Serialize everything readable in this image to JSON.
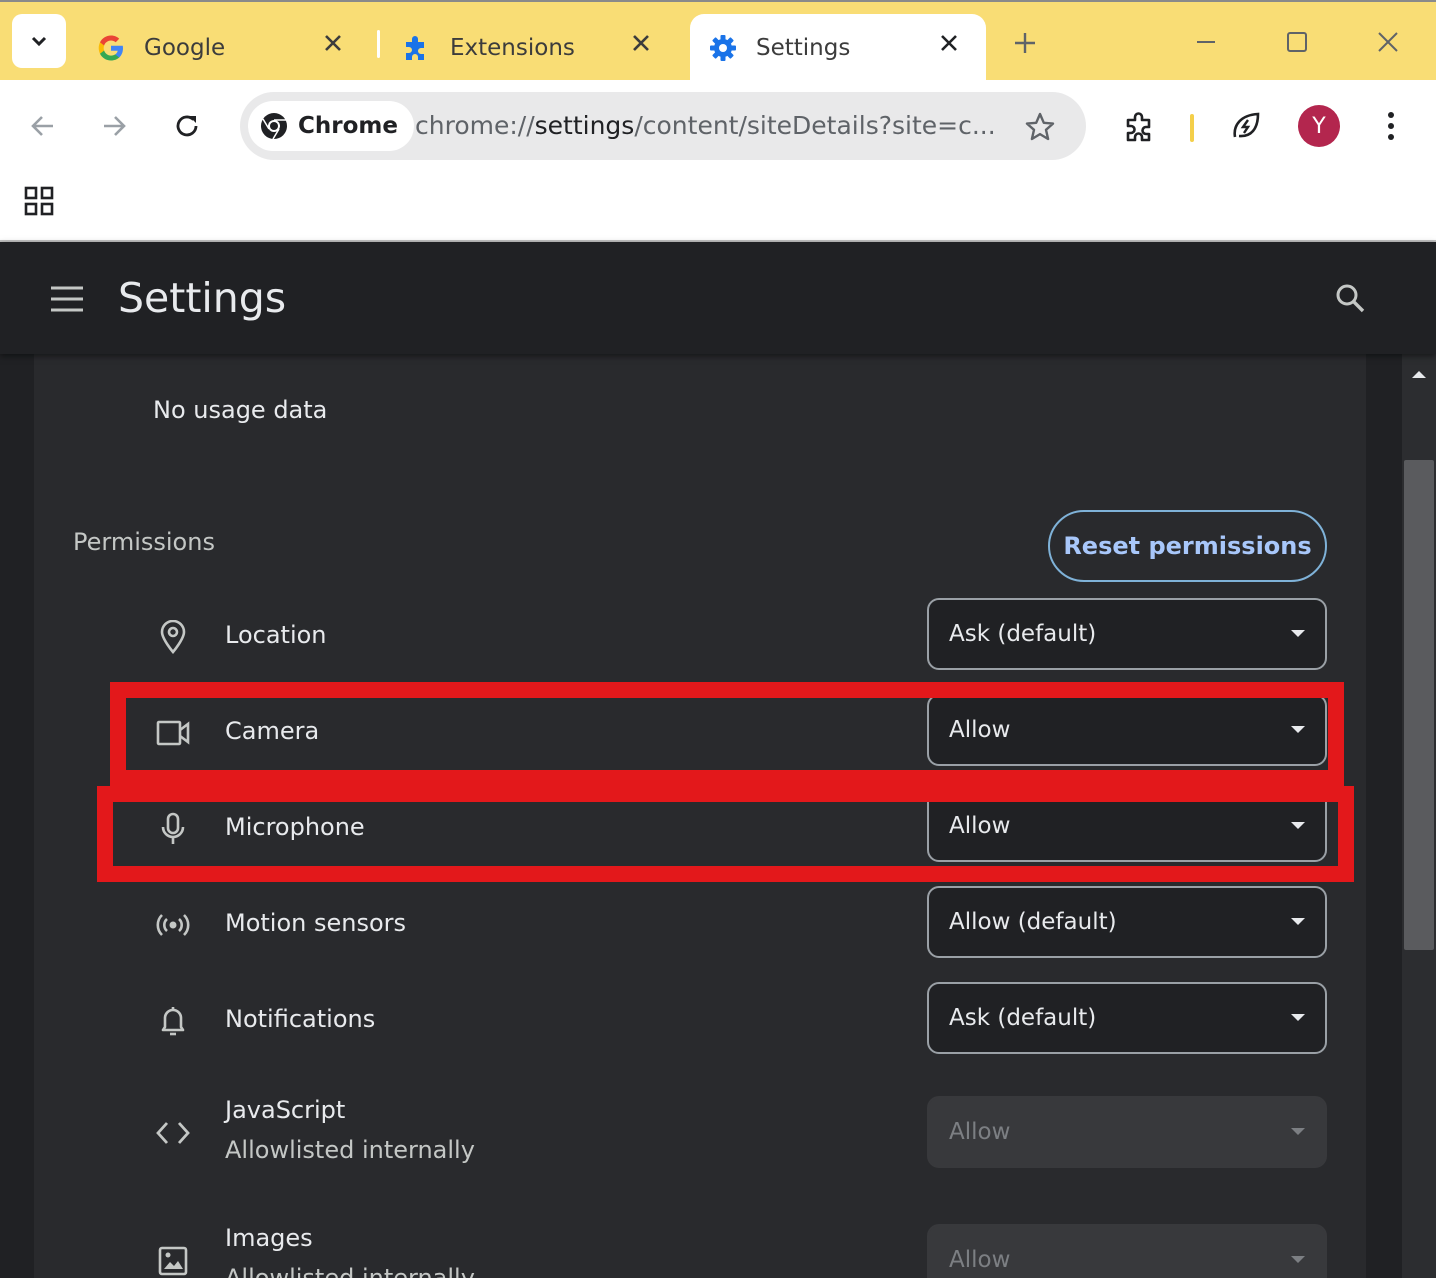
{
  "tabs": [
    {
      "title": "Google",
      "icon": "google-icon"
    },
    {
      "title": "Extensions",
      "icon": "puzzle-icon"
    },
    {
      "title": "Settings",
      "icon": "gear-icon",
      "active": true
    }
  ],
  "omnibox": {
    "chip_label": "Chrome",
    "url_prefix": "chrome://",
    "url_host": "settings",
    "url_rest": "/content/siteDetails?site=c..."
  },
  "avatar_letter": "Y",
  "settings": {
    "title": "Settings",
    "usage_text": "No usage data",
    "permissions_heading": "Permissions",
    "reset_button": "Reset permissions"
  },
  "permissions": [
    {
      "label": "Location",
      "value": "Ask (default)",
      "icon": "location-icon",
      "disabled": false
    },
    {
      "label": "Camera",
      "value": "Allow",
      "icon": "camera-icon",
      "disabled": false,
      "highlighted": true
    },
    {
      "label": "Microphone",
      "value": "Allow",
      "icon": "microphone-icon",
      "disabled": false,
      "highlighted": true
    },
    {
      "label": "Motion sensors",
      "value": "Allow (default)",
      "icon": "sensors-icon",
      "disabled": false
    },
    {
      "label": "Notifications",
      "value": "Ask (default)",
      "icon": "bell-icon",
      "disabled": false
    },
    {
      "label": "JavaScript",
      "sublabel": "Allowlisted internally",
      "value": "Allow",
      "icon": "code-icon",
      "disabled": true
    },
    {
      "label": "Images",
      "sublabel": "Allowlisted internally",
      "value": "Allow",
      "icon": "image-icon",
      "disabled": true
    }
  ],
  "colors": {
    "tab_strip": "#f9dd75",
    "highlight": "#e3181b",
    "accent": "#a8c7fa",
    "avatar": "#b3264e"
  }
}
